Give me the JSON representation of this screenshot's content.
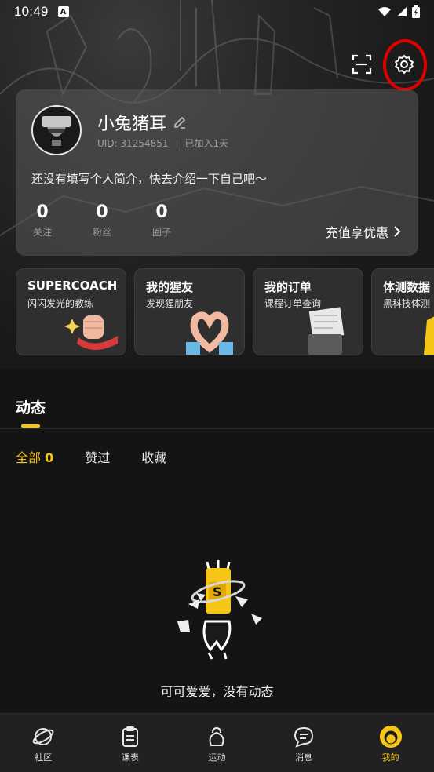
{
  "status_bar": {
    "time": "10:49",
    "a_badge": "A"
  },
  "profile": {
    "username": "小兔猪耳",
    "uid": "UID: 31254851",
    "joined": "已加入1天",
    "bio": "还没有填写个人简介，快去介绍一下自己吧～",
    "stats": [
      {
        "value": "0",
        "label": "关注"
      },
      {
        "value": "0",
        "label": "粉丝"
      },
      {
        "value": "0",
        "label": "圈子"
      }
    ],
    "recharge_label": "充值享优惠"
  },
  "features": [
    {
      "title": "SUPERCOACH",
      "subtitle": "闪闪发光的教练"
    },
    {
      "title": "我的猩友",
      "subtitle": "发现猩朋友"
    },
    {
      "title": "我的订单",
      "subtitle": "课程订单查询"
    },
    {
      "title": "体测数据",
      "subtitle": "黑科技体测"
    }
  ],
  "activity": {
    "section_title": "动态",
    "tabs": [
      {
        "label": "全部",
        "count": "0"
      },
      {
        "label": "赞过"
      },
      {
        "label": "收藏"
      }
    ],
    "empty_text": "可可爱爱，没有动态"
  },
  "bottom_nav": [
    {
      "label": "社区",
      "icon": "planet-icon"
    },
    {
      "label": "课表",
      "icon": "clipboard-icon"
    },
    {
      "label": "运动",
      "icon": "kettlebell-icon"
    },
    {
      "label": "消息",
      "icon": "message-icon"
    },
    {
      "label": "我的",
      "icon": "avatar-face-icon"
    }
  ],
  "colors": {
    "accent": "#f5c518",
    "highlight_ring": "#e00000",
    "background": "#141414"
  }
}
